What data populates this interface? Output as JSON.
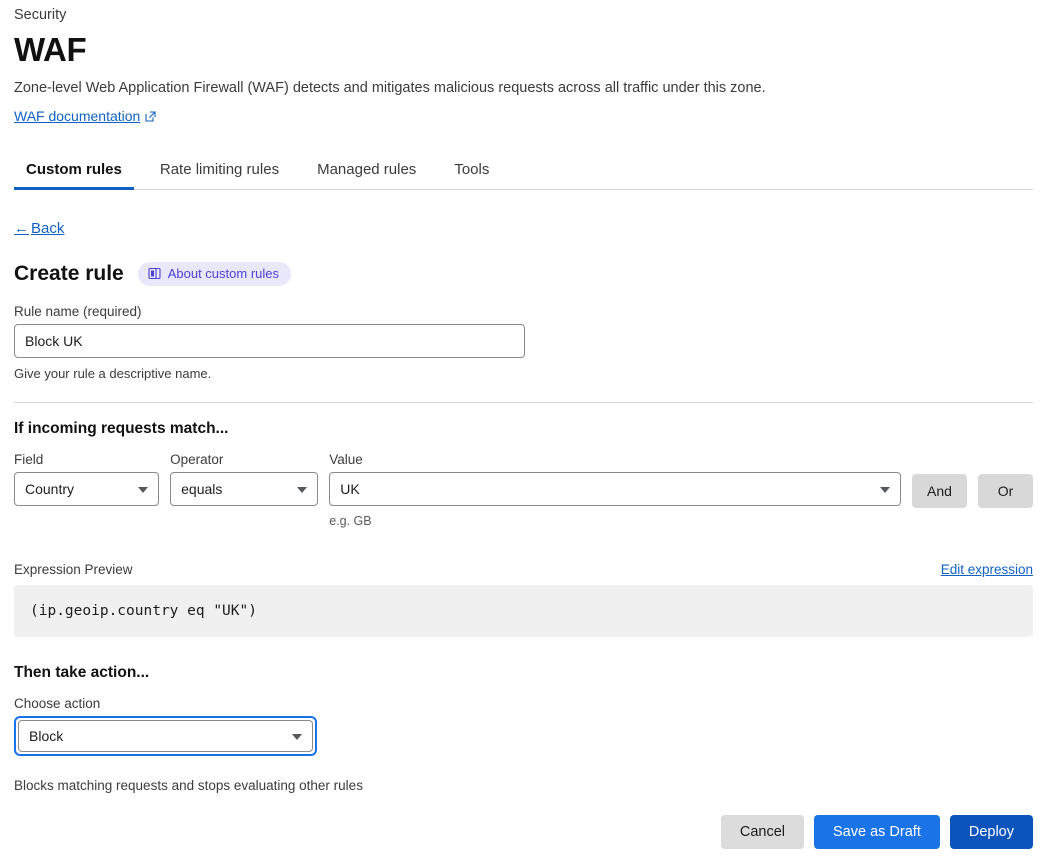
{
  "header": {
    "breadcrumb": "Security",
    "title": "WAF",
    "description": "Zone-level Web Application Firewall (WAF) detects and mitigates malicious requests across all traffic under this zone.",
    "doc_link": "WAF documentation",
    "doc_link_icon": "external-link-icon"
  },
  "tabs": [
    {
      "label": "Custom rules",
      "active": true
    },
    {
      "label": "Rate limiting rules",
      "active": false
    },
    {
      "label": "Managed rules",
      "active": false
    },
    {
      "label": "Tools",
      "active": false
    }
  ],
  "back": {
    "arrow": "←",
    "label": "Back"
  },
  "create": {
    "title": "Create rule",
    "about_pill_label": "About custom rules",
    "about_pill_icon": "book-icon",
    "about_pill_bg": "#e9e8fb",
    "about_pill_fg": "#4b3fd6"
  },
  "rule_name": {
    "label": "Rule name (required)",
    "value": "Block UK",
    "placeholder": "Enter rule name",
    "help": "Give your rule a descriptive name."
  },
  "match_section": {
    "heading": "If incoming requests match...",
    "field": {
      "label": "Field",
      "value": "Country"
    },
    "operator": {
      "label": "Operator",
      "value": "equals"
    },
    "value": {
      "label": "Value",
      "value": "UK",
      "hint": "e.g. GB"
    },
    "and_label": "And",
    "or_label": "Or"
  },
  "expression": {
    "label": "Expression Preview",
    "edit_label": "Edit expression",
    "code": "(ip.geoip.country eq \"UK\")"
  },
  "action_section": {
    "heading": "Then take action...",
    "label": "Choose action",
    "value": "Block",
    "help": "Blocks matching requests and stops evaluating other rules",
    "focus_color": "#1872e8"
  },
  "footer": {
    "cancel": "Cancel",
    "save_draft": "Save as Draft",
    "deploy": "Deploy",
    "draft_color": "#1b73e8",
    "deploy_color": "#0b54bc"
  }
}
